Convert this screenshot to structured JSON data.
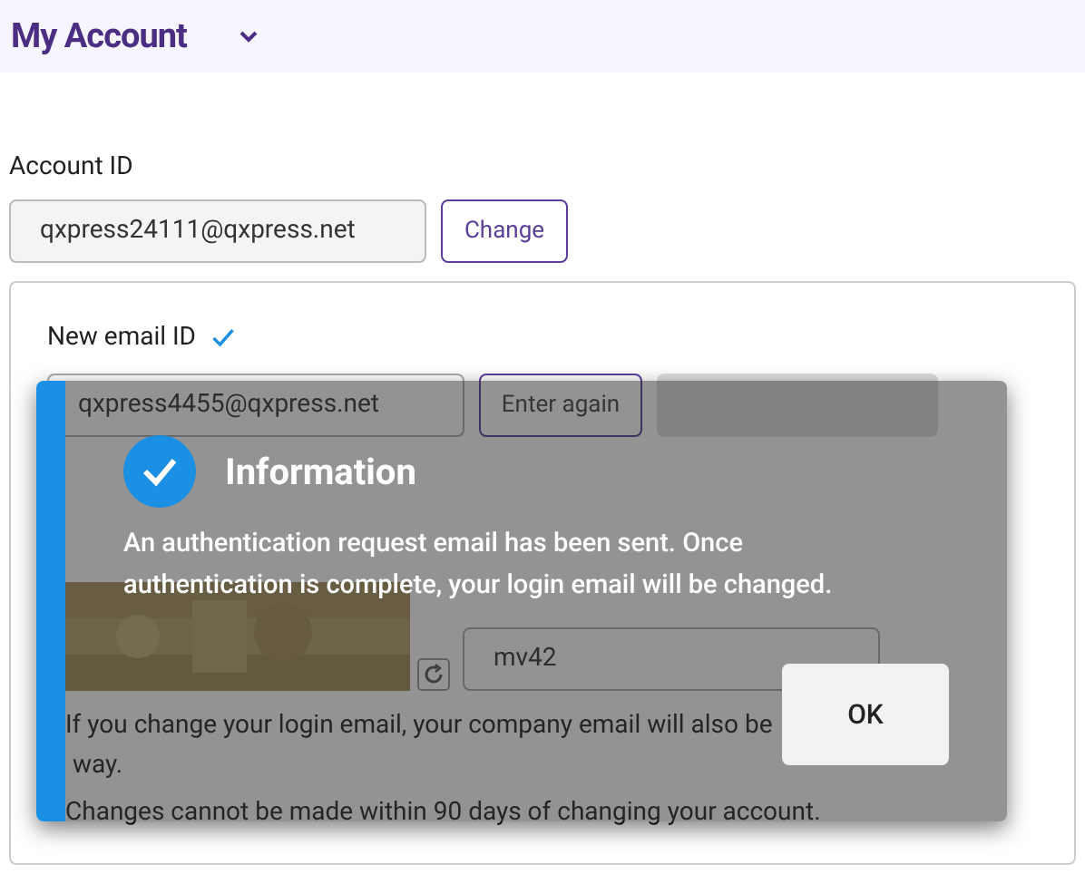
{
  "header": {
    "title": "My Account"
  },
  "account": {
    "label": "Account ID",
    "value": "qxpress24111@qxpress.net",
    "button": "Change"
  },
  "new_email": {
    "label": "New email ID",
    "verified": true,
    "value": "qxpress4455@qxpress.net",
    "button": "Enter again"
  },
  "captcha": {
    "value": "mv42"
  },
  "notices": [
    "If you change your login email, your company email will also be",
    "way.",
    "Changes cannot be made within 90 days of changing your account."
  ],
  "dialog": {
    "title": "Information",
    "message": "An authentication request email has been sent. Once authentication is complete, your login email will be changed.",
    "button": "OK"
  }
}
